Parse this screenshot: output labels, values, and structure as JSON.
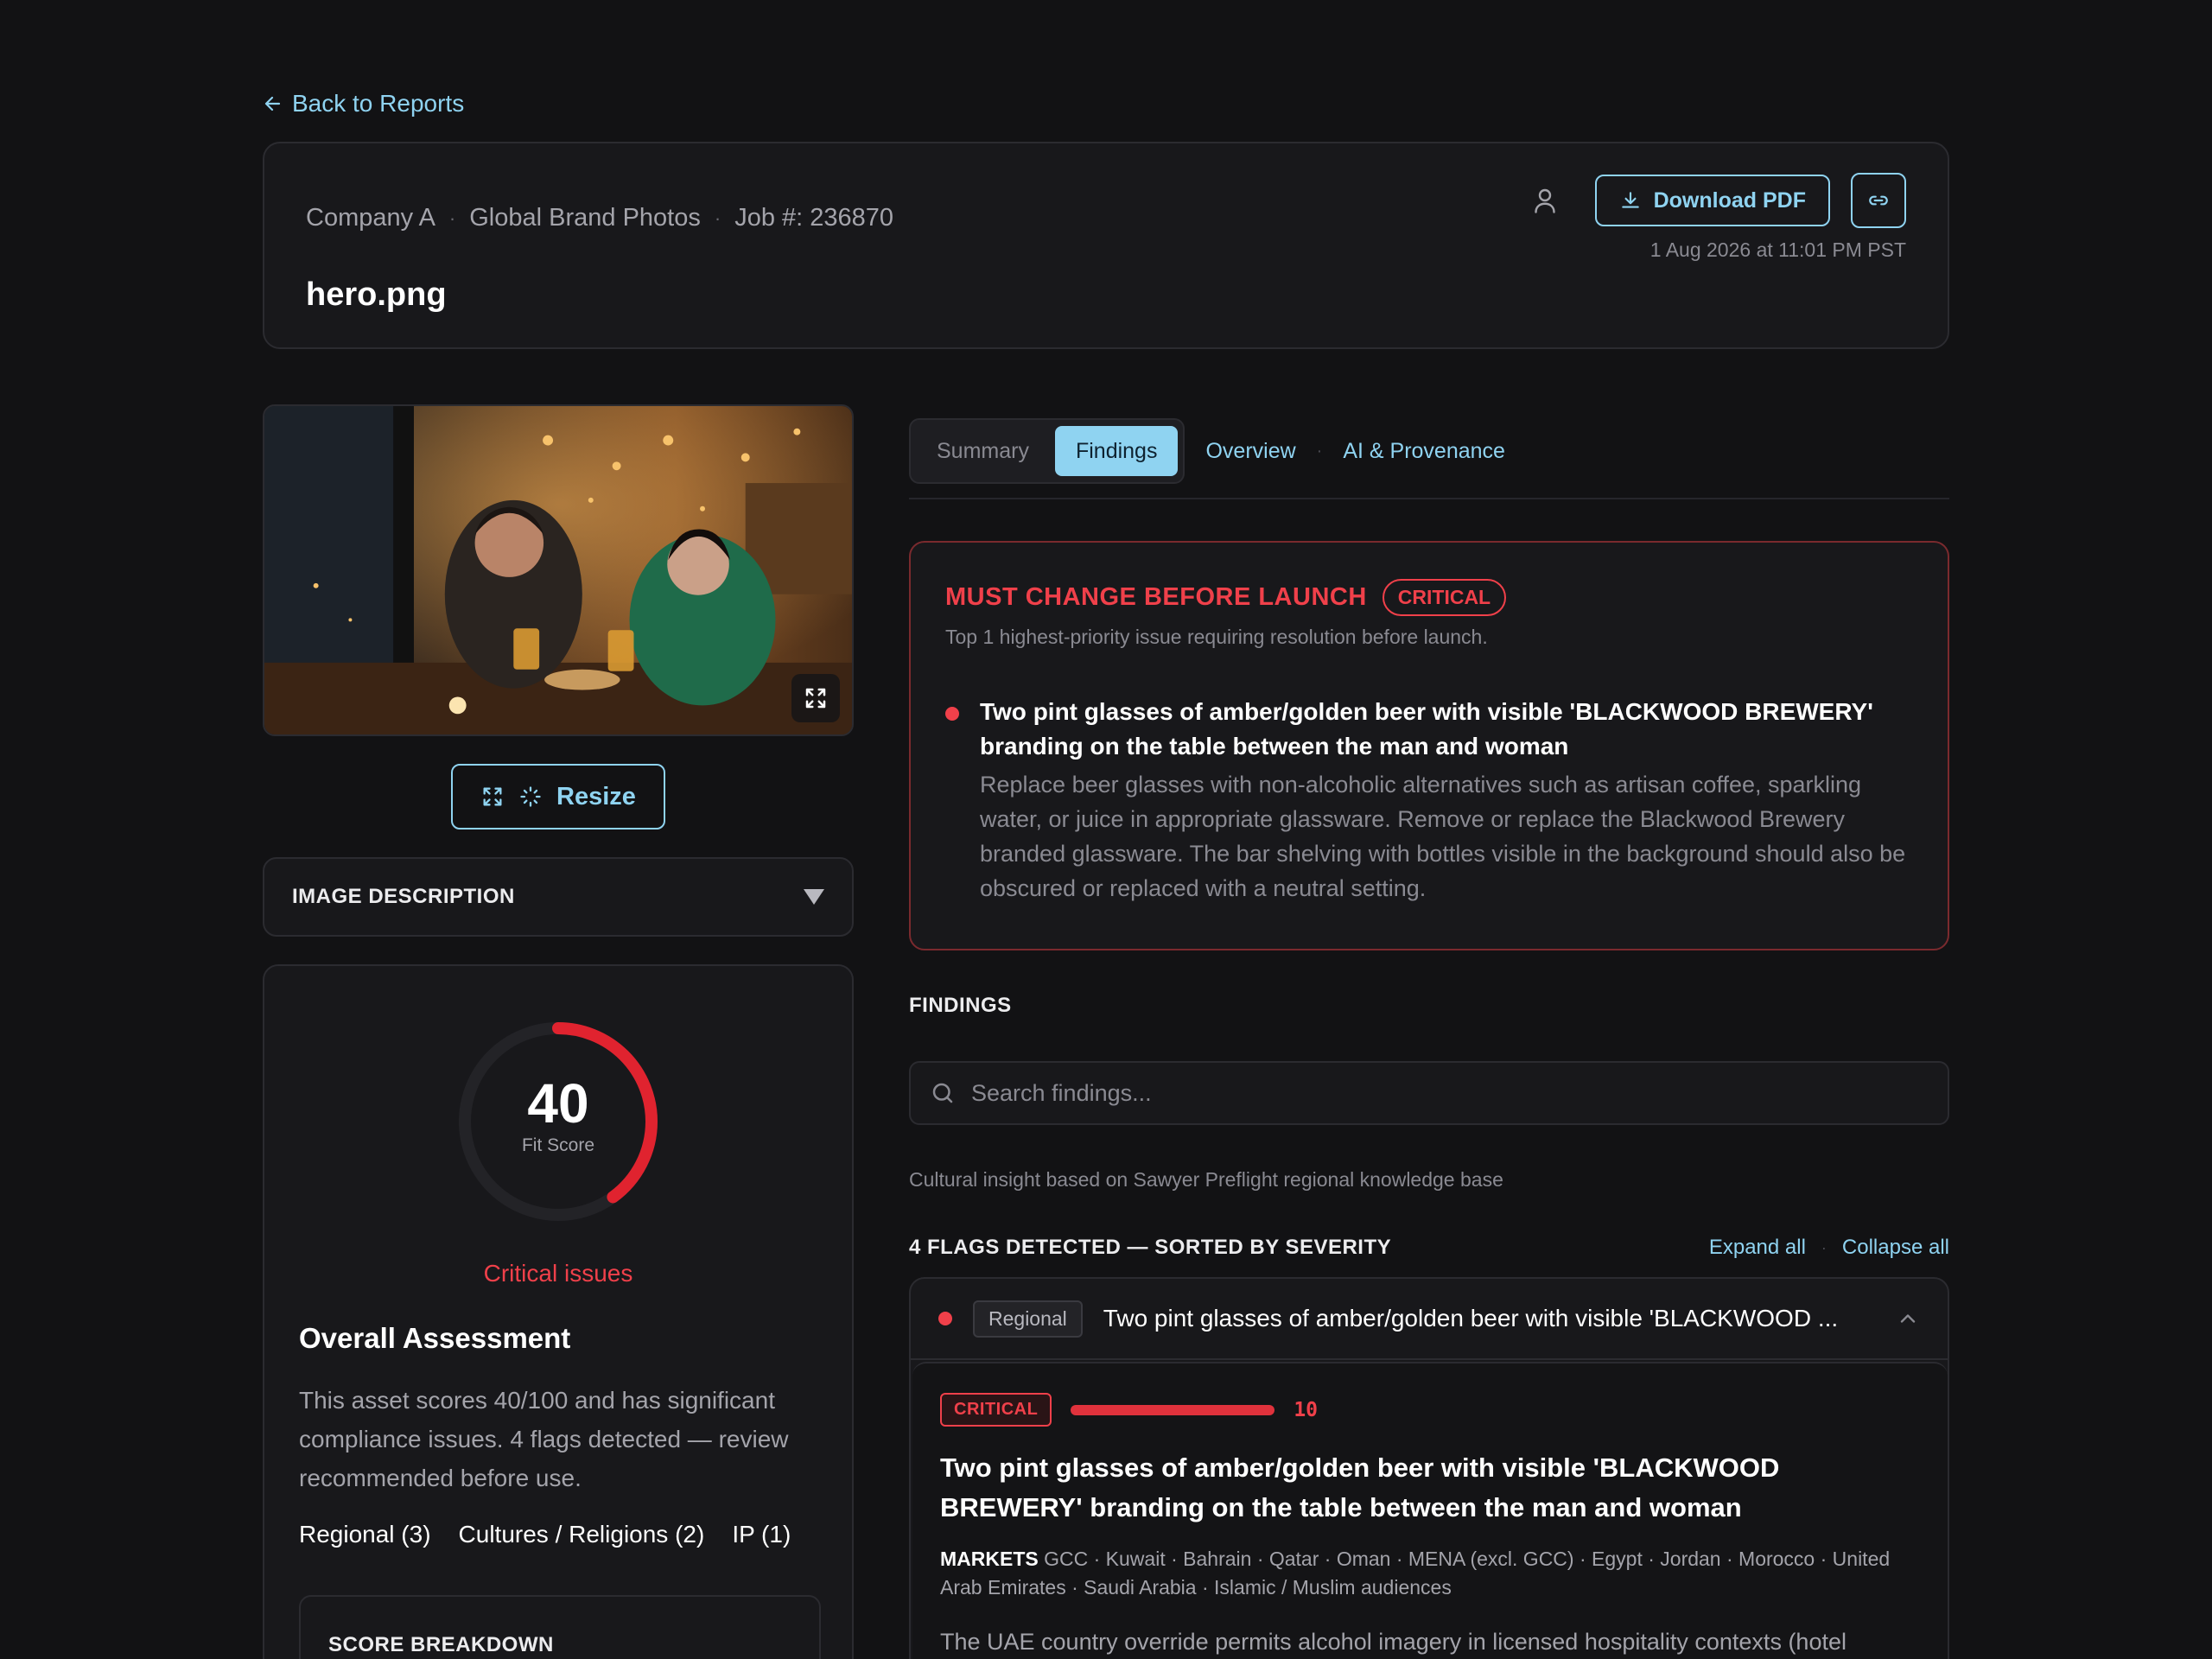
{
  "nav": {
    "back_label": "Back to Reports"
  },
  "header": {
    "company": "Company A",
    "project": "Global Brand Photos",
    "job": "Job #: 236870",
    "filename": "hero.png",
    "download_label": "Download PDF",
    "timestamp": "1 Aug 2026 at 11:01 PM PST"
  },
  "image": {
    "resize_label": "Resize",
    "description_label": "IMAGE DESCRIPTION"
  },
  "score": {
    "value": "40",
    "max": 100,
    "caption": "Fit Score",
    "status": "Critical issues",
    "assessment_title": "Overall Assessment",
    "assessment_text": "This asset scores 40/100 and has significant compliance issues. 4 flags detected — review recommended before use.",
    "categories": [
      "Regional (3)",
      "Cultures / Religions (2)",
      "IP (1)"
    ],
    "breakdown_label": "SCORE BREAKDOWN"
  },
  "tabs": {
    "summary": "Summary",
    "findings": "Findings",
    "overview": "Overview",
    "provenance": "AI & Provenance",
    "active": "findings"
  },
  "must_change": {
    "title": "MUST CHANGE BEFORE LAUNCH",
    "badge": "CRITICAL",
    "subtitle": "Top 1 highest-priority issue requiring resolution before launch.",
    "item_title": "Two pint glasses of amber/golden beer with visible 'BLACKWOOD BREWERY' branding on the table between the man and woman",
    "item_body": "Replace beer glasses with non-alcoholic alternatives such as artisan coffee, sparkling water, or juice in appropriate glassware. Remove or replace the Blackwood Brewery branded glassware. The bar shelving with bottles visible in the background should also be obscured or replaced with a neutral setting."
  },
  "findings": {
    "heading": "FINDINGS",
    "search_placeholder": "Search findings...",
    "insight": "Cultural insight based on Sawyer Preflight regional knowledge base",
    "flags_summary": "4 FLAGS DETECTED — SORTED BY SEVERITY",
    "expand_all": "Expand all",
    "collapse_all": "Collapse all"
  },
  "flag": {
    "category": "Regional",
    "title_short": "Two pint glasses of amber/golden beer with visible 'BLACKWOOD ...",
    "severity_label": "CRITICAL",
    "severity_value": "10",
    "severity_fraction": 1.0,
    "title": "Two pint glasses of amber/golden beer with visible 'BLACKWOOD BREWERY' branding on the table between the man and woman",
    "markets_label": "MARKETS",
    "markets": "GCC · Kuwait · Bahrain · Qatar · Oman · MENA (excl. GCC) · Egypt · Jordan · Morocco · United Arab Emirates · Saudi Arabia · Islamic / Muslim audiences",
    "override_text": "The UAE country override permits alcohol imagery in licensed hospitality contexts (hotel"
  },
  "colors": {
    "accent": "#8FD3F1",
    "critical": "#F0404A",
    "background": "#121214",
    "card": "#18181B"
  }
}
